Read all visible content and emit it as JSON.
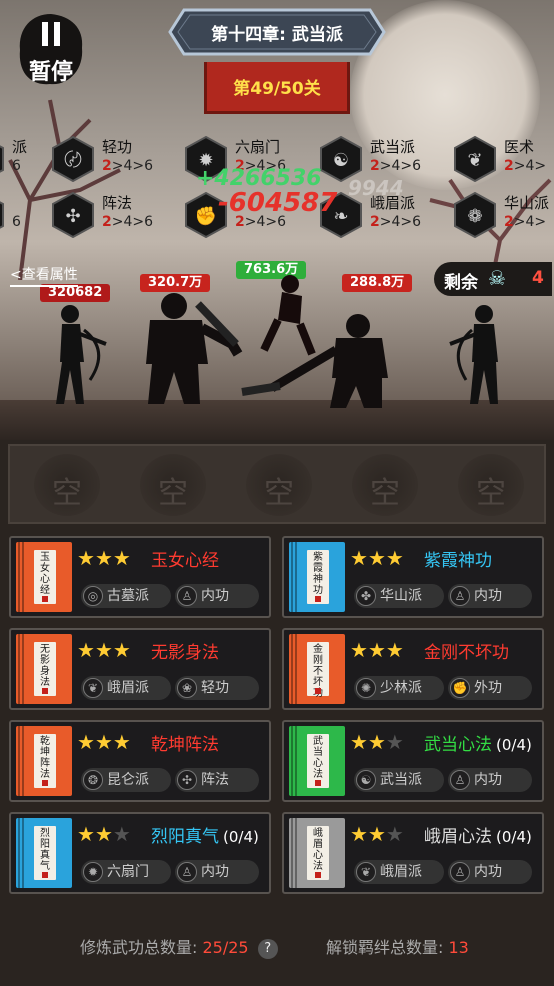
{
  "hud": {
    "pause_label": "暂停",
    "chapter_title": "第十四章: 武当派",
    "stage_label": "第49/50关",
    "view_attributes": "<查看属性",
    "remaining_label": "剩余",
    "remaining_count": "4"
  },
  "factions": [
    {
      "name": "派",
      "progress": [
        "",
        "6"
      ],
      "partial": "left"
    },
    {
      "name": "轻功",
      "progress": [
        "2",
        ">4>6"
      ]
    },
    {
      "name": "六扇门",
      "progress": [
        "2",
        ">4>6"
      ]
    },
    {
      "name": "武当派",
      "progress": [
        "2",
        ">4>6"
      ]
    },
    {
      "name": "医术",
      "progress": [
        "2",
        ">4>"
      ],
      "partial": "right"
    },
    {
      "name": "",
      "progress": [
        "",
        "6"
      ],
      "partial": "left"
    },
    {
      "name": "阵法",
      "progress": [
        "2",
        ">4>6"
      ]
    },
    {
      "name": "",
      "progress": [
        "2",
        ">4>6"
      ]
    },
    {
      "name": "峨眉派",
      "progress": [
        "2",
        ">4>6"
      ]
    },
    {
      "name": "华山派",
      "progress": [
        "2",
        ">4>"
      ],
      "partial": "right"
    }
  ],
  "floating_numbers": {
    "heal": "+4266536",
    "damage": "-604587",
    "faint": "9944"
  },
  "enemies_hp": [
    "320682",
    "320.7万",
    "763.6万",
    "288.8万"
  ],
  "slots": [
    "空",
    "空",
    "空",
    "空",
    "空"
  ],
  "skills": [
    {
      "name": "玉女心经",
      "stars": 3,
      "count": "",
      "name_color": "#ff3b30",
      "book_color": "#e85b2a",
      "book_text": "玉女心经",
      "sect": "古墓派",
      "type": "内功"
    },
    {
      "name": "紫霞神功",
      "stars": 3,
      "count": "",
      "name_color": "#35c6f4",
      "book_color": "#2aa3dc",
      "book_text": "紫霞神功",
      "sect": "华山派",
      "type": "内功"
    },
    {
      "name": "无影身法",
      "stars": 3,
      "count": "",
      "name_color": "#ff3b30",
      "book_color": "#e85b2a",
      "book_text": "无影身法",
      "sect": "峨眉派",
      "type": "轻功"
    },
    {
      "name": "金刚不坏功",
      "stars": 3,
      "count": "",
      "name_color": "#ff3b30",
      "book_color": "#e85b2a",
      "book_text": "金刚不坏功",
      "sect": "少林派",
      "type": "外功"
    },
    {
      "name": "乾坤阵法",
      "stars": 3,
      "count": "",
      "name_color": "#ff3b30",
      "book_color": "#e85b2a",
      "book_text": "乾坤阵法",
      "sect": "昆仑派",
      "type": "阵法"
    },
    {
      "name": "武当心法",
      "stars": 2,
      "count": "(0/4)",
      "name_color": "#33dd44",
      "book_color": "#2db84a",
      "book_text": "武当心法",
      "sect": "武当派",
      "type": "内功"
    },
    {
      "name": "烈阳真气",
      "stars": 2,
      "count": "(0/4)",
      "name_color": "#35c6f4",
      "book_color": "#2aa3dc",
      "book_text": "烈阳真气",
      "sect": "六扇门",
      "type": "内功"
    },
    {
      "name": "峨眉心法",
      "stars": 2,
      "count": "(0/4)",
      "name_color": "#dddddd",
      "book_color": "#9a9a9a",
      "book_text": "峨眉心法",
      "sect": "峨眉派",
      "type": "内功"
    }
  ],
  "footer": {
    "trained_label": "修炼武功总数量:",
    "trained_value": "25/25",
    "help": "?",
    "bonds_label": "解锁羁绊总数量:",
    "bonds_value": "13"
  },
  "colors": {
    "stage_banner": "#b0281e",
    "card_bg": "#1c1b1d",
    "star_on": "#ffcc33",
    "accent_red": "#ff4b3a"
  }
}
